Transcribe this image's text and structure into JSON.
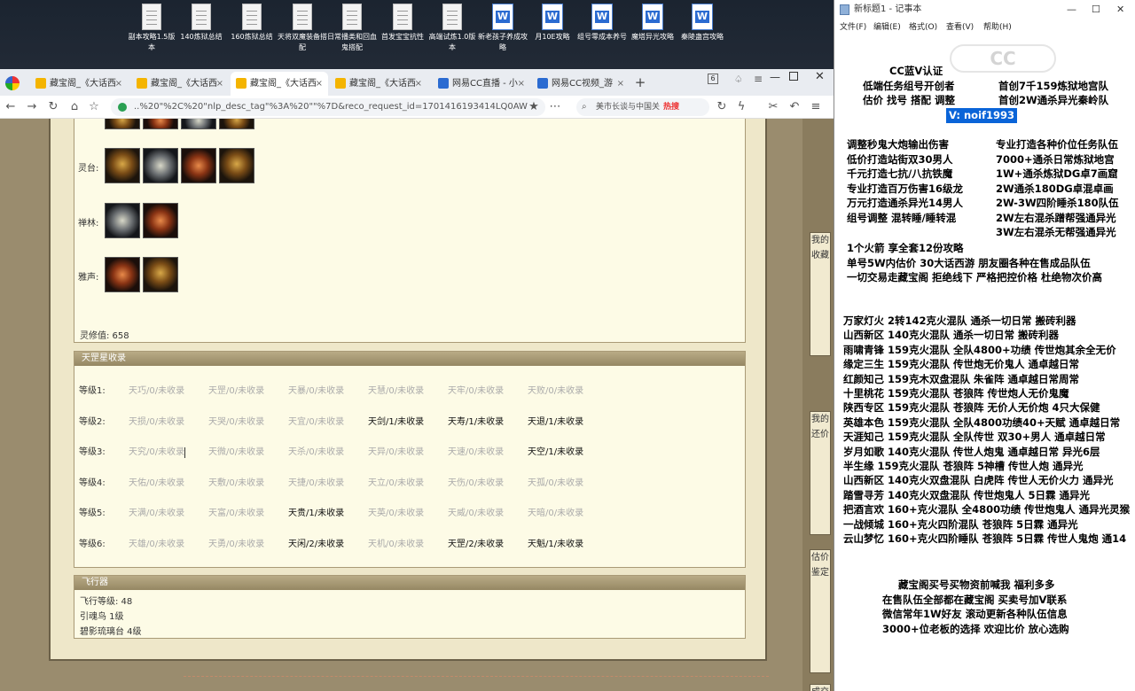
{
  "desktop": {
    "icons": [
      {
        "label": "副本攻略1.5版本",
        "type": "doc"
      },
      {
        "label": "140炼狱总结",
        "type": "doc"
      },
      {
        "label": "160炼狱总结",
        "type": "doc"
      },
      {
        "label": "天将双魔装备搭配",
        "type": "doc"
      },
      {
        "label": "日常播类和回血鬼搭配",
        "type": "doc"
      },
      {
        "label": "首发宝宝抗性",
        "type": "doc"
      },
      {
        "label": "高端试炼1.0版本",
        "type": "doc"
      },
      {
        "label": "新老孩子养成攻略",
        "type": "word"
      },
      {
        "label": "月10E攻略",
        "type": "word"
      },
      {
        "label": "组号零成本养号",
        "type": "word"
      },
      {
        "label": "魔塔异光攻略",
        "type": "word"
      },
      {
        "label": "秦陵蛊宫攻略",
        "type": "word"
      }
    ]
  },
  "browser": {
    "tabs": [
      {
        "label": "藏宝阁_《大话西",
        "active": false
      },
      {
        "label": "藏宝阁_《大话西",
        "active": false
      },
      {
        "label": "藏宝阁_《大话西",
        "active": true
      },
      {
        "label": "藏宝阁_《大话西",
        "active": false
      },
      {
        "label": "网易CC直播 - 小",
        "active": false
      },
      {
        "label": "网易CC视频_游",
        "active": false
      }
    ],
    "tab_count": "6",
    "url": "..%20\"%2C%20\"nlp_desc_tag\"%3A%20\"\"%7D&reco_request_id=1701416193414LQ0AW",
    "search_text": "美市长谈与中国关",
    "search_hot": "热搜"
  },
  "game": {
    "item_rows": [
      {
        "label": "灵台:",
        "icon_count": 4
      },
      {
        "label": "禅林:",
        "icon_count": 2
      },
      {
        "label": "雅声:",
        "icon_count": 2
      }
    ],
    "lingxiu": "灵修值:  658",
    "star_panel": {
      "title": "天罡星收录",
      "rows": [
        {
          "level": "等级1:",
          "cells": [
            {
              "text": "天巧/0/未收录",
              "on": false
            },
            {
              "text": "天罡/0/未收录",
              "on": false
            },
            {
              "text": "天暴/0/未收录",
              "on": false
            },
            {
              "text": "天慧/0/未收录",
              "on": false
            },
            {
              "text": "天牢/0/未收录",
              "on": false
            },
            {
              "text": "天败/0/未收录",
              "on": false
            }
          ]
        },
        {
          "level": "等级2:",
          "cells": [
            {
              "text": "天损/0/未收录",
              "on": false
            },
            {
              "text": "天哭/0/未收录",
              "on": false
            },
            {
              "text": "天宜/0/未收录",
              "on": false
            },
            {
              "text": "天剑/1/未收录",
              "on": true
            },
            {
              "text": "天寿/1/未收录",
              "on": true
            },
            {
              "text": "天退/1/未收录",
              "on": true
            }
          ]
        },
        {
          "level": "等级3:",
          "cells": [
            {
              "text": "天究/0/未收录",
              "on": false
            },
            {
              "text": "天微/0/未收录",
              "on": false
            },
            {
              "text": "天杀/0/未收录",
              "on": false
            },
            {
              "text": "天异/0/未收录",
              "on": false
            },
            {
              "text": "天速/0/未收录",
              "on": false
            },
            {
              "text": "天空/1/未收录",
              "on": true
            }
          ]
        },
        {
          "level": "等级4:",
          "cells": [
            {
              "text": "天佑/0/未收录",
              "on": false
            },
            {
              "text": "天敷/0/未收录",
              "on": false
            },
            {
              "text": "天捷/0/未收录",
              "on": false
            },
            {
              "text": "天立/0/未收录",
              "on": false
            },
            {
              "text": "天伤/0/未收录",
              "on": false
            },
            {
              "text": "天孤/0/未收录",
              "on": false
            }
          ]
        },
        {
          "level": "等级5:",
          "cells": [
            {
              "text": "天满/0/未收录",
              "on": false
            },
            {
              "text": "天富/0/未收录",
              "on": false
            },
            {
              "text": "天贵/1/未收录",
              "on": true
            },
            {
              "text": "天英/0/未收录",
              "on": false
            },
            {
              "text": "天威/0/未收录",
              "on": false
            },
            {
              "text": "天暗/0/未收录",
              "on": false
            }
          ]
        },
        {
          "level": "等级6:",
          "cells": [
            {
              "text": "天雄/0/未收录",
              "on": false
            },
            {
              "text": "天勇/0/未收录",
              "on": false
            },
            {
              "text": "天闲/2/未收录",
              "on": true
            },
            {
              "text": "天机/0/未收录",
              "on": false
            },
            {
              "text": "天罡/2/未收录",
              "on": true
            },
            {
              "text": "天魁/1/未收录",
              "on": true
            }
          ]
        }
      ]
    },
    "flight_panel": {
      "title": "飞行器",
      "lines": [
        "飞行等级:  48",
        "引魂鸟   1级",
        "碧影琉璃台   4级"
      ]
    },
    "right_strips": [
      {
        "text": "我的收藏"
      },
      {
        "text": "我的还价"
      },
      {
        "text": "估价鉴定"
      },
      {
        "text": "成交查询"
      }
    ]
  },
  "notepad": {
    "title": "新标题1 - 记事本",
    "menu": [
      "文件(F)",
      "编辑(E)",
      "格式(O)",
      "查看(V)",
      "帮助(H)"
    ],
    "header_lines": [
      {
        "text": "CC蓝V认证",
        "left": "x"
      },
      {
        "text": "低端任务组号开创者",
        "right": "首创7千159炼狱地宫队"
      },
      {
        "text": "估价 找号 搭配 调整",
        "right": "首创2W通杀异光秦岭队"
      }
    ],
    "contact": "V:  noif1993",
    "services": [
      [
        "调整秒鬼大炮输出伤害",
        "专业打造各种价位任务队伍"
      ],
      [
        "低价打造站街双30男人",
        "7000+通杀日常炼狱地宫"
      ],
      [
        "千元打造七抗/八抗铁魔",
        "1W+通杀炼狱DG卓7画窟"
      ],
      [
        "专业打造百万伤害16级龙",
        "2W通杀180DG卓混卓画"
      ],
      [
        "万元打造通杀异光14男人",
        "2W-3W四阶睡杀180队伍"
      ],
      [
        "组号调整 混转睡/睡转混",
        "2W左右混杀蹭帮强通异光"
      ],
      [
        "",
        "3W左右混杀无帮强通异光"
      ]
    ],
    "extras": [
      "1个火箭 享全套12份攻略",
      "单号5W内估价 30大话西游        朋友圈各种在售成品队伍",
      "一切交易走藏宝阁 拒绝线下    严格把控价格 杜绝物次价高"
    ],
    "teams": [
      "万家灯火 2转142克火混队 通杀一切日常 搬砖利器",
      "山西新区 140克火混队 通杀一切日常 搬砖利器",
      "雨啸青锋 159克火混队 全队4800+功绩 传世炮其余全无价",
      "缘定三生 159克火混队 传世炮无价鬼人 通卓越日常",
      "红颜知己 159克木双盘混队 朱雀阵 通卓越日常周常",
      "十里桃花 159克火混队 苍狼阵 传世炮人无价鬼魔",
      "陕西专区 159克火混队 苍狼阵 无价人无价炮 4只大保健",
      "英雄本色 159克火混队 全队4800功绩40+天赋 通卓越日常",
      "天涯知己 159克火混队 全队传世 双30+男人 通卓越日常",
      "岁月如歌 140克火混队 传世人炮鬼 通卓越日常 异光6层",
      "半生缘    159克火混队 苍狼阵 5神槽 传世人炮 通异光",
      "山西新区 140克火双盘混队 白虎阵 传世人无价火力 通异光",
      "踏雪寻芳 140克火双盘混队 传世炮鬼人 5日霖 通异光",
      "把酒言欢 160+克火混队 全4800功绩 传世炮鬼人 通异光灵猴",
      "一战倾城 160+克火四阶混队 苍狼阵 5日霖 通异光",
      "云山梦忆 160+克火四阶睡队 苍狼阵 5日霖 传世人鬼炮 通14"
    ],
    "footer": [
      "藏宝阁买号买物资前喊我 福利多多",
      "在售队伍全部都在藏宝阁 买卖号加V联系",
      "微信常年1W好友 滚动更新各种队伍信息",
      "3000+位老板的选择 欢迎比价 放心选购"
    ]
  }
}
